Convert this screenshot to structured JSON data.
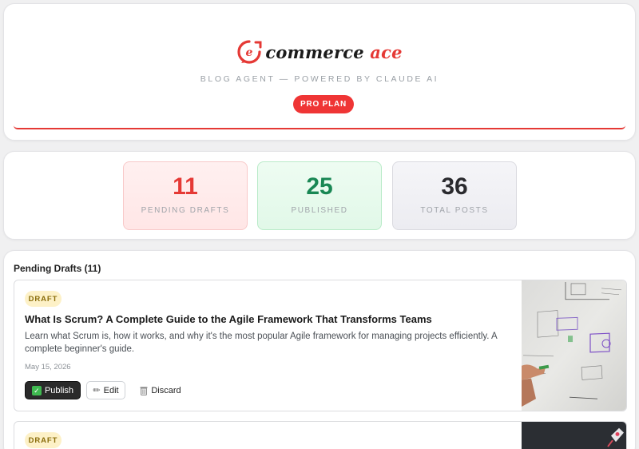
{
  "header": {
    "logo_mark": "e",
    "logo_word1": "commerce",
    "logo_word2": "ace",
    "subtitle": "BLOG AGENT — POWERED BY CLAUDE AI",
    "plan_badge": "PRO PLAN",
    "accent_color": "#e53935"
  },
  "stats": [
    {
      "value": "11",
      "label": "PENDING DRAFTS",
      "color": "#e53935"
    },
    {
      "value": "25",
      "label": "PUBLISHED",
      "color": "#198754"
    },
    {
      "value": "36",
      "label": "TOTAL POSTS",
      "color": "#2a2a2e"
    }
  ],
  "drafts_section": {
    "title": "Pending Drafts (11)",
    "items": [
      {
        "badge": "DRAFT",
        "title": "What Is Scrum? A Complete Guide to the Agile Framework That Transforms Teams",
        "description": "Learn what Scrum is, how it works, and why it's the most popular Agile framework for managing projects efficiently. A complete beginner's guide.",
        "date": "May 15, 2026",
        "actions": {
          "publish": "Publish",
          "edit": "Edit",
          "discard": "Discard"
        },
        "thumbnail": "whiteboard-photo"
      },
      {
        "badge": "DRAFT",
        "thumbnail": "dark-photo"
      }
    ]
  },
  "icons": {
    "publish": "check-box-icon",
    "edit": "pencil-icon",
    "discard": "trash-icon"
  }
}
